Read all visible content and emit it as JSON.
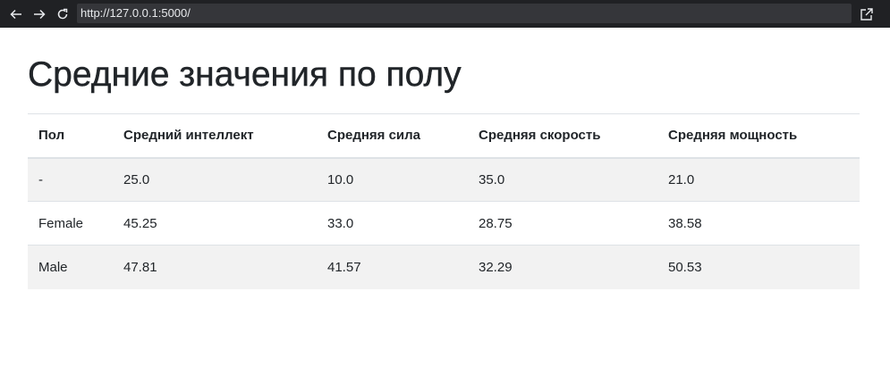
{
  "browser": {
    "url": "http://127.0.0.1:5000/"
  },
  "page": {
    "title": "Средние значения по полу"
  },
  "table": {
    "headers": [
      "Пол",
      "Средний интеллект",
      "Средняя сила",
      "Средняя скорость",
      "Средняя мощность"
    ],
    "rows": [
      [
        "-",
        "25.0",
        "10.0",
        "35.0",
        "21.0"
      ],
      [
        "Female",
        "45.25",
        "33.0",
        "28.75",
        "38.58"
      ],
      [
        "Male",
        "47.81",
        "41.57",
        "32.29",
        "50.53"
      ]
    ]
  },
  "icons": {
    "back": "arrow-left-icon",
    "forward": "arrow-right-icon",
    "reload": "reload-icon",
    "open": "open-external-icon"
  }
}
